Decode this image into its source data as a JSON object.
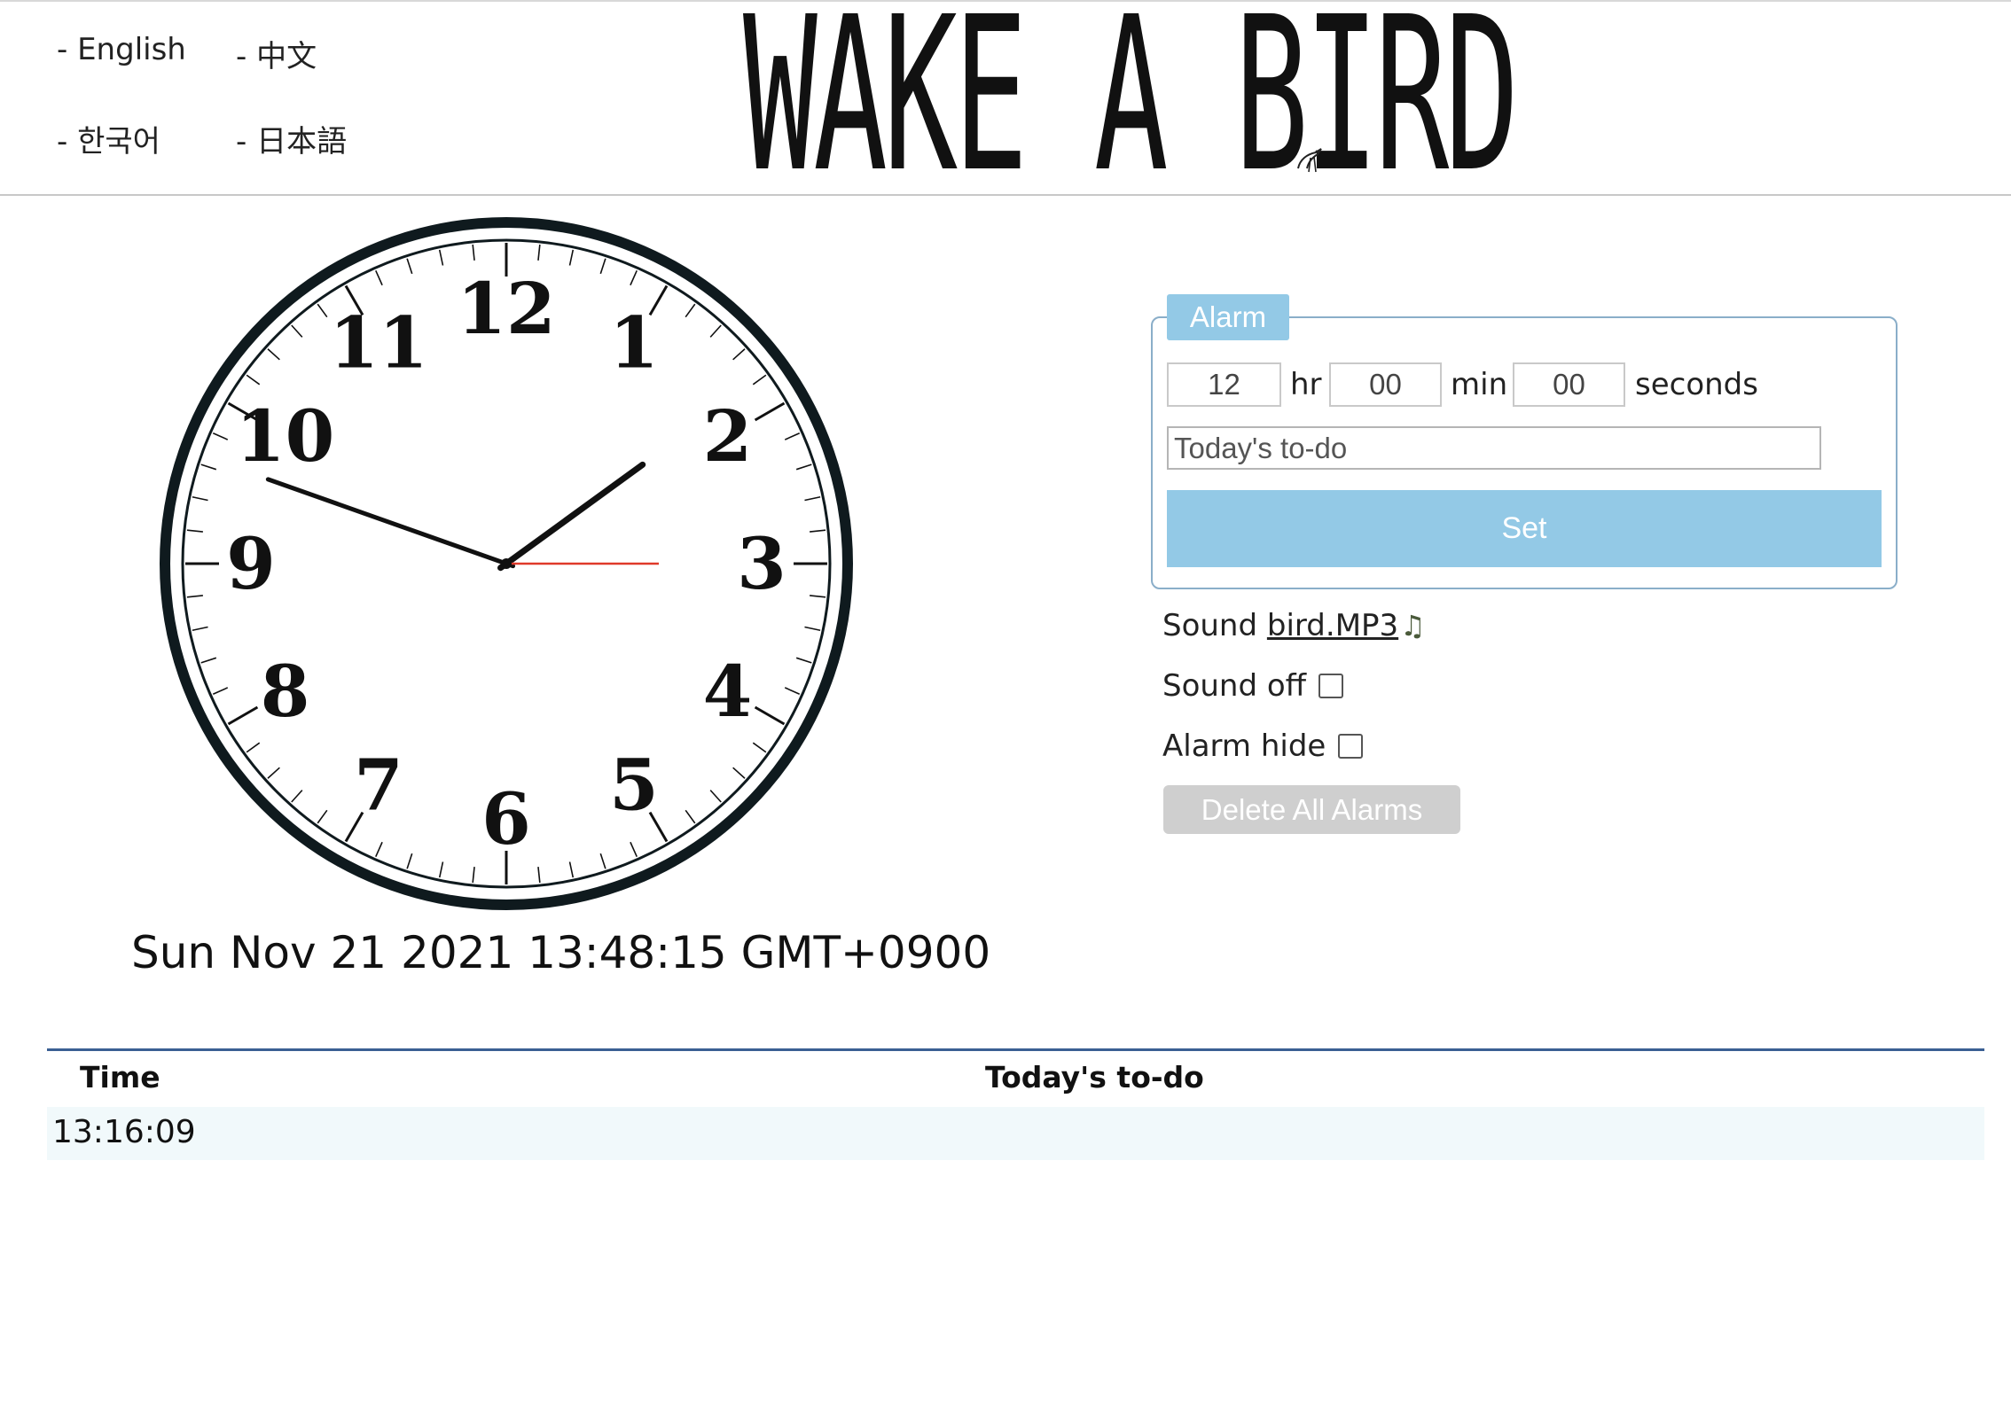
{
  "languages": [
    "- English",
    "- 中文",
    "- 한국어",
    "- 日本語"
  ],
  "logo": {
    "text": "WAKE A BIRD",
    "icon": "bird-icon"
  },
  "clock": {
    "numerals": [
      "12",
      "1",
      "2",
      "3",
      "4",
      "5",
      "6",
      "7",
      "8",
      "9",
      "10",
      "11"
    ],
    "time": {
      "hours": 13,
      "minutes": 48,
      "seconds": 15
    },
    "colors": {
      "face": "#ffffff",
      "rim": "#0f1a1e",
      "hands": "#111111",
      "second_hand": "#e03a2a"
    }
  },
  "datetime": "Sun Nov 21 2021 13:48:15 GMT+0900",
  "alarm": {
    "legend": "Alarm",
    "hour_value": "12",
    "minute_value": "00",
    "second_value": "00",
    "hr_label": "hr",
    "min_label": "min",
    "sec_label": "seconds",
    "todo_placeholder": "Today's to-do",
    "set_label": "Set",
    "accent_color": "#93c9e6"
  },
  "options": {
    "sound_label": "Sound",
    "sound_file": "bird.MP3",
    "sound_icon": "♫",
    "sound_off_label": "Sound off",
    "sound_off_checked": false,
    "alarm_hide_label": "Alarm hide",
    "alarm_hide_checked": false,
    "delete_label": "Delete All Alarms"
  },
  "table": {
    "headers": [
      "Time",
      "Today's to-do"
    ],
    "rows": [
      {
        "time": "13:16:09",
        "todo": ""
      }
    ]
  }
}
